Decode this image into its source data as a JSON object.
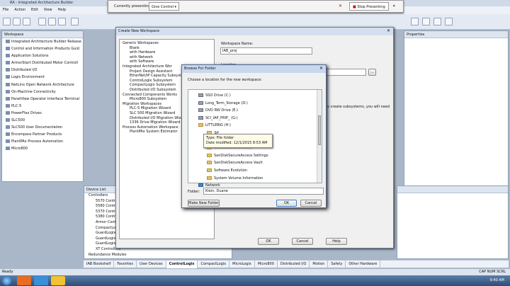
{
  "app": {
    "title": "RA - Integrated Architecture Builder",
    "menu": [
      "File",
      "Action",
      "Edit",
      "View",
      "Help"
    ]
  },
  "presenting": {
    "label": "Currently presenting",
    "control_label": "Give Control",
    "stop_label": "Stop Presenting"
  },
  "workspace_pane": {
    "title": "Workspace",
    "items": [
      "Integrated Architecture Builder Release",
      "Control and Information Products Guid",
      "Application Solutions",
      "ArmorStart Distributed Motor Controll",
      "Distributed I/O",
      "Logix Environment",
      "NetLinx Open Network Architecture",
      "On-Machine Connectivity",
      "PanelView Operator Interface Terminal",
      "PLC-5",
      "PowerFlex Drives",
      "SLC500",
      "SLC500 User Documentation",
      "Encompass Partner Products",
      "PlantPAx Process Automation",
      "Micro800"
    ]
  },
  "properties_pane": {
    "title": "Properties"
  },
  "device_list": {
    "title": "Device List",
    "items": [
      "Controllers",
      "5570 Contr",
      "5580 Contr",
      "5370 Contr",
      "5380 Contr",
      "Armor Cont",
      "CompactLo",
      "GuardLogix",
      "GuardLogix",
      "GuardLogix",
      "XT Controllers",
      "Redundance Modules"
    ]
  },
  "create_workspace": {
    "title": "Create New Workspace",
    "templates": [
      "Generic Workspaces",
      "Blank",
      "with Hardware",
      "with Network",
      "with Software",
      "Integrated Architecture Wor",
      "Project Design Assistant",
      "EtherNet/IP Capacity Subsyst",
      "ControlLogix Subsystem",
      "CompactLogix Subsystem",
      "Distributed I/O Subsystem",
      "Connected Components Works",
      "Micro800 Subsystem",
      "Migration Workspaces",
      "PLC-5 Migration Wizard",
      "SLC 500 Migration Wizard",
      "Distributed I/O Migration Wizard",
      "1336 Drive Migration Wizard",
      "Process Automation Workspace",
      "PlantPAx System Estimator"
    ],
    "name_label": "Workspace Name:",
    "name_value": "IAB_proj",
    "location_label": "Location",
    "browse_label": "...",
    "desc_fragment": "o create subsystems, you will need",
    "ok": "OK",
    "cancel": "Cancel",
    "help": "Help"
  },
  "browse_folder": {
    "title": "Browse For Folder",
    "prompt": "Choose a location for the new workspace:",
    "tree": [
      "SSO Drive (C:)",
      "Long_Term_Storage (D:)",
      "DVD RW Drive (E:)",
      "SCI_IAP_PRIP_ (G:)",
      "LITTLEBIG (H:)",
      "\\bf",
      "ff",
      "SanDiskSecureAccess",
      "SanDiskSecureAccess Settings",
      "SanDiskSecureAccess Vault",
      "Software Evolution",
      "System Volume Information",
      "Network"
    ],
    "folder_label": "Folder:",
    "folder_value": "Klein, Duane",
    "make_new": "Make New Folder",
    "ok": "OK",
    "cancel": "Cancel"
  },
  "tooltip": {
    "line1": "Type: File folder",
    "line2": "Date modified: 12/1/2015 8:53 AM"
  },
  "bottom_tabs": [
    "IAB Bookshelf",
    "Favorites",
    "User Devices",
    "ControlLogix",
    "CompactLogix",
    "MicroLogix",
    "Micro800",
    "Distributed I/O",
    "Motion",
    "Safety",
    "Other Hardware"
  ],
  "status": {
    "left": "Ready",
    "right": "CAP  NUM  SCRL"
  },
  "taskbar": {
    "time": "9:40 AM"
  }
}
